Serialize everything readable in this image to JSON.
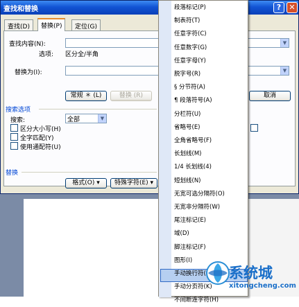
{
  "dialog": {
    "title": "查找和替换",
    "help_glyph": "?",
    "close_glyph": "✕",
    "tabs": [
      {
        "label": "查找(D)"
      },
      {
        "label": "替换(P)"
      },
      {
        "label": "定位(G)"
      }
    ],
    "find_label": "查找内容(N):",
    "options_label": "选项:",
    "options_value": "区分全/半角",
    "replace_label": "替换为(I):",
    "find_value": "",
    "replace_value": "",
    "buttons": {
      "less": "常规 ＊ (L)",
      "replace": "替换 (R)",
      "cancel": "取消",
      "format": "格式(O) ▾",
      "special": "特殊字符(E) ▾"
    },
    "search_options_title": "搜索选项",
    "search_label": "搜索:",
    "search_value": "全部",
    "checkboxes": [
      {
        "label": "区分大小写(H)",
        "checked": false
      },
      {
        "label": "全字匹配(Y)",
        "checked": false
      },
      {
        "label": "使用通配符(U)",
        "checked": false
      }
    ],
    "replace_section_title": "替换"
  },
  "special_menu": {
    "items": [
      "段落标记(P)",
      "制表符(T)",
      "任意字符(C)",
      "任意数字(G)",
      "任意字母(Y)",
      "脱字号(R)",
      "§ 分节符(A)",
      "¶ 段落符号(A)",
      "分栏符(U)",
      "省略号(E)",
      "全角省略号(F)",
      "长划线(M)",
      "1/4 长划线(4)",
      "短划线(N)",
      "无宽可选分隔符(O)",
      "无宽非分隔符(W)",
      "尾注标记(E)",
      "域(D)",
      "脚注标记(F)",
      "图形(I)",
      "手动换行符(L)",
      "手动分页符(K)",
      "不间断连字符(H)"
    ],
    "highlighted_index": 21
  },
  "watermark": {
    "text": "系统城",
    "url": "xitongcheng.com",
    "color": "#1a6fc9"
  }
}
